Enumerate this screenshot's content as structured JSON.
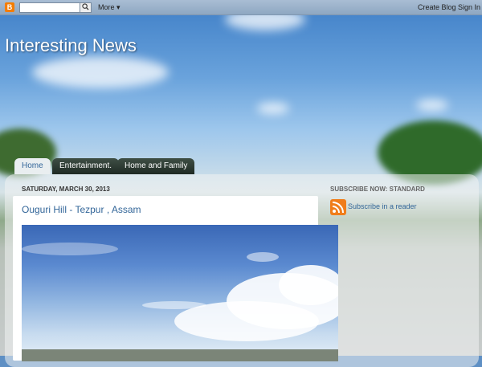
{
  "navbar": {
    "logo_letter": "B",
    "search_button_icon": "magnifier-icon",
    "more_label": "More ▾",
    "create_blog_label": "Create Blog",
    "sign_in_label": "Sign In"
  },
  "blog": {
    "title": "Interesting News"
  },
  "tabs": [
    {
      "label": "Home",
      "active": true
    },
    {
      "label": "Entertainment."
    },
    {
      "label": "Home and Family"
    }
  ],
  "post": {
    "date": "SATURDAY, MARCH 30, 2013",
    "title": "Ouguri Hill - Tezpur , Assam"
  },
  "sidebar": {
    "heading": "SUBSCRIBE NOW: STANDARD",
    "subscribe_label": "Subscribe in a reader",
    "rss_icon": "rss-feed-icon"
  }
}
